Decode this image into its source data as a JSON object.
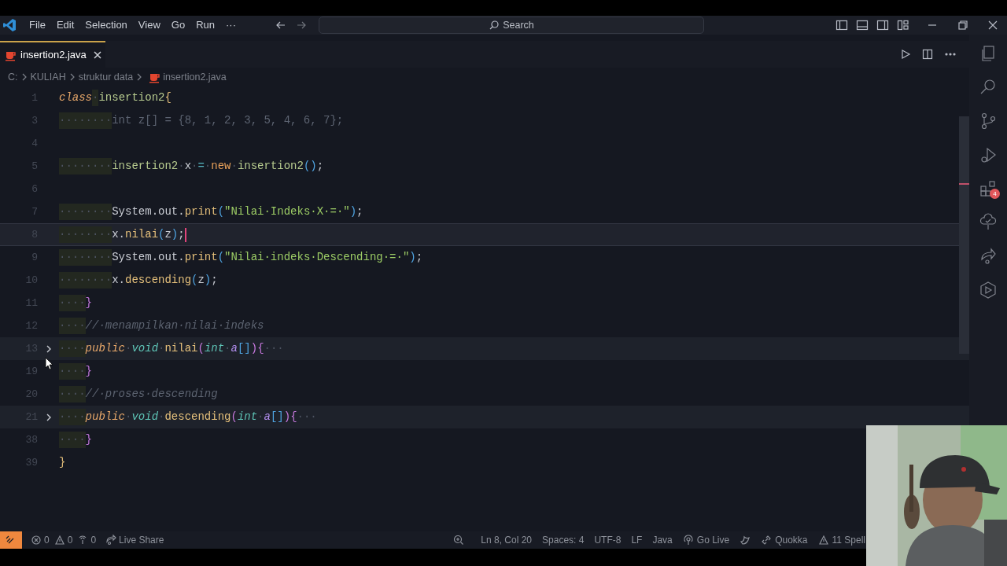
{
  "menu": [
    "File",
    "Edit",
    "Selection",
    "View",
    "Go",
    "Run",
    "···"
  ],
  "search": {
    "placeholder": "Search"
  },
  "tabs": [
    {
      "label": "insertion2.java",
      "selected": true
    }
  ],
  "breadcrumbs": [
    "C:",
    "KULIAH",
    "struktur data",
    "insertion2.java"
  ],
  "editor": {
    "lines": [
      {
        "number": "1",
        "current": false,
        "folded": false,
        "cursor": false,
        "tokens": [
          {
            "kind": "kw",
            "text": "class"
          },
          {
            "kind": "ws",
            "text": "·"
          },
          {
            "kind": "cls",
            "text": "insertion2"
          },
          {
            "kind": "brace",
            "text": "{"
          }
        ]
      },
      {
        "number": "3",
        "current": false,
        "folded": false,
        "cursor": false,
        "tokens": [
          {
            "kind": "ws",
            "text": "····"
          },
          {
            "kind": "ws",
            "text": "····"
          },
          {
            "kind": "dim",
            "text": "int z[] = {8, 1, 2, 3, 5, 4, 6, 7};"
          }
        ]
      },
      {
        "number": "4",
        "current": false,
        "folded": false,
        "cursor": false
      },
      {
        "number": "5",
        "current": false,
        "folded": false,
        "cursor": false,
        "tokens": [
          {
            "kind": "ws",
            "text": "····"
          },
          {
            "kind": "ws",
            "text": "····"
          },
          {
            "kind": "cls",
            "text": "insertion2"
          },
          {
            "kind": "ws",
            "text": "·"
          },
          {
            "kind": "plain",
            "text": "x"
          },
          {
            "kind": "ws",
            "text": "·"
          },
          {
            "kind": "op",
            "text": "="
          },
          {
            "kind": "ws",
            "text": "·"
          },
          {
            "kind": "new",
            "text": "new"
          },
          {
            "kind": "ws",
            "text": "·"
          },
          {
            "kind": "cls",
            "text": "insertion2"
          },
          {
            "kind": "paren",
            "text": "()"
          },
          {
            "kind": "plain",
            "text": ";"
          }
        ]
      },
      {
        "number": "6",
        "current": false,
        "folded": false,
        "cursor": false
      },
      {
        "number": "7",
        "current": false,
        "folded": false,
        "cursor": false,
        "tokens": [
          {
            "kind": "ws",
            "text": "····"
          },
          {
            "kind": "ws",
            "text": "····"
          },
          {
            "kind": "plain",
            "text": "System.out."
          },
          {
            "kind": "fn",
            "text": "print"
          },
          {
            "kind": "paren",
            "text": "("
          },
          {
            "kind": "str",
            "text": "\"Nilai·Indeks·X·=·\""
          },
          {
            "kind": "paren",
            "text": ")"
          },
          {
            "kind": "plain",
            "text": ";"
          }
        ]
      },
      {
        "number": "8",
        "current": true,
        "folded": false,
        "cursor": true,
        "tokens": [
          {
            "kind": "ws",
            "text": "····"
          },
          {
            "kind": "ws",
            "text": "····"
          },
          {
            "kind": "plain",
            "text": "x."
          },
          {
            "kind": "fn",
            "text": "nilai"
          },
          {
            "kind": "paren",
            "text": "("
          },
          {
            "kind": "plain",
            "text": "z"
          },
          {
            "kind": "paren",
            "text": ")"
          },
          {
            "kind": "plain",
            "text": ";"
          }
        ]
      },
      {
        "number": "9",
        "current": false,
        "folded": false,
        "cursor": false,
        "tokens": [
          {
            "kind": "ws",
            "text": "····"
          },
          {
            "kind": "ws",
            "text": "····"
          },
          {
            "kind": "plain",
            "text": "System.out."
          },
          {
            "kind": "fn",
            "text": "print"
          },
          {
            "kind": "paren",
            "text": "("
          },
          {
            "kind": "str",
            "text": "\"Nilai·indeks·Descending·=·\""
          },
          {
            "kind": "paren",
            "text": ")"
          },
          {
            "kind": "plain",
            "text": ";"
          }
        ]
      },
      {
        "number": "10",
        "current": false,
        "folded": false,
        "cursor": false,
        "tokens": [
          {
            "kind": "ws",
            "text": "····"
          },
          {
            "kind": "ws",
            "text": "····"
          },
          {
            "kind": "plain",
            "text": "x."
          },
          {
            "kind": "fn",
            "text": "descending"
          },
          {
            "kind": "paren",
            "text": "("
          },
          {
            "kind": "plain",
            "text": "z"
          },
          {
            "kind": "paren",
            "text": ")"
          },
          {
            "kind": "plain",
            "text": ";"
          }
        ]
      },
      {
        "number": "11",
        "current": false,
        "folded": false,
        "cursor": false,
        "tokens": [
          {
            "kind": "ws",
            "text": "····"
          },
          {
            "kind": "brace2",
            "text": "}"
          }
        ]
      },
      {
        "number": "12",
        "current": false,
        "folded": false,
        "cursor": false,
        "tokens": [
          {
            "kind": "ws",
            "text": "····"
          },
          {
            "kind": "comment",
            "text": "//·menampilkan·nilai·indeks"
          }
        ]
      },
      {
        "number": "13",
        "current": false,
        "folded": true,
        "cursor": false,
        "tokens": [
          {
            "kind": "ws",
            "text": "····"
          },
          {
            "kind": "kw",
            "text": "public"
          },
          {
            "kind": "ws",
            "text": "·"
          },
          {
            "kind": "type",
            "text": "void"
          },
          {
            "kind": "ws",
            "text": "·"
          },
          {
            "kind": "fn",
            "text": "nilai"
          },
          {
            "kind": "paren2",
            "text": "("
          },
          {
            "kind": "type",
            "text": "int"
          },
          {
            "kind": "ws",
            "text": "·"
          },
          {
            "kind": "var",
            "text": "a"
          },
          {
            "kind": "paren",
            "text": "[]"
          },
          {
            "kind": "paren2",
            "text": ")"
          },
          {
            "kind": "brace2",
            "text": "{"
          },
          {
            "kind": "ws",
            "text": "···"
          }
        ]
      },
      {
        "number": "19",
        "current": false,
        "folded": false,
        "cursor": false,
        "tokens": [
          {
            "kind": "ws",
            "text": "····"
          },
          {
            "kind": "brace2",
            "text": "}"
          }
        ]
      },
      {
        "number": "20",
        "current": false,
        "folded": false,
        "cursor": false,
        "tokens": [
          {
            "kind": "ws",
            "text": "····"
          },
          {
            "kind": "comment",
            "text": "//·proses·descending"
          }
        ]
      },
      {
        "number": "21",
        "current": false,
        "folded": true,
        "cursor": false,
        "tokens": [
          {
            "kind": "ws",
            "text": "····"
          },
          {
            "kind": "kw",
            "text": "public"
          },
          {
            "kind": "ws",
            "text": "·"
          },
          {
            "kind": "type",
            "text": "void"
          },
          {
            "kind": "ws",
            "text": "·"
          },
          {
            "kind": "fn",
            "text": "descending"
          },
          {
            "kind": "paren2",
            "text": "("
          },
          {
            "kind": "type",
            "text": "int"
          },
          {
            "kind": "ws",
            "text": "·"
          },
          {
            "kind": "var",
            "text": "a"
          },
          {
            "kind": "paren",
            "text": "[]"
          },
          {
            "kind": "paren2",
            "text": ")"
          },
          {
            "kind": "brace2",
            "text": "{"
          },
          {
            "kind": "ws",
            "text": "···"
          }
        ]
      },
      {
        "number": "38",
        "current": false,
        "folded": false,
        "cursor": false,
        "tokens": [
          {
            "kind": "ws",
            "text": "····"
          },
          {
            "kind": "brace2",
            "text": "}"
          }
        ]
      },
      {
        "number": "39",
        "current": false,
        "folded": false,
        "cursor": false,
        "tokens": [
          {
            "kind": "brace",
            "text": "}"
          }
        ]
      }
    ]
  },
  "activity_badge": "4",
  "status_bar": {
    "left": [
      {
        "kind": "errors",
        "text": "0"
      },
      {
        "kind": "warnings",
        "text": "0"
      },
      {
        "kind": "ports",
        "text": "0"
      },
      {
        "kind": "liveshare",
        "text": "Live Share"
      }
    ],
    "right": [
      {
        "kind": "zoom"
      },
      {
        "kind": "text",
        "text": "Ln 8, Col 20"
      },
      {
        "kind": "text",
        "text": "Spaces: 4"
      },
      {
        "kind": "text",
        "text": "UTF-8"
      },
      {
        "kind": "text",
        "text": "LF"
      },
      {
        "kind": "text",
        "text": "Java"
      },
      {
        "kind": "golive",
        "text": "Go Live"
      },
      {
        "kind": "feedback"
      },
      {
        "kind": "quokka",
        "text": "Quokka"
      },
      {
        "kind": "spell",
        "text": "11 Spell"
      }
    ]
  },
  "webcam": {
    "kind": "picture"
  }
}
